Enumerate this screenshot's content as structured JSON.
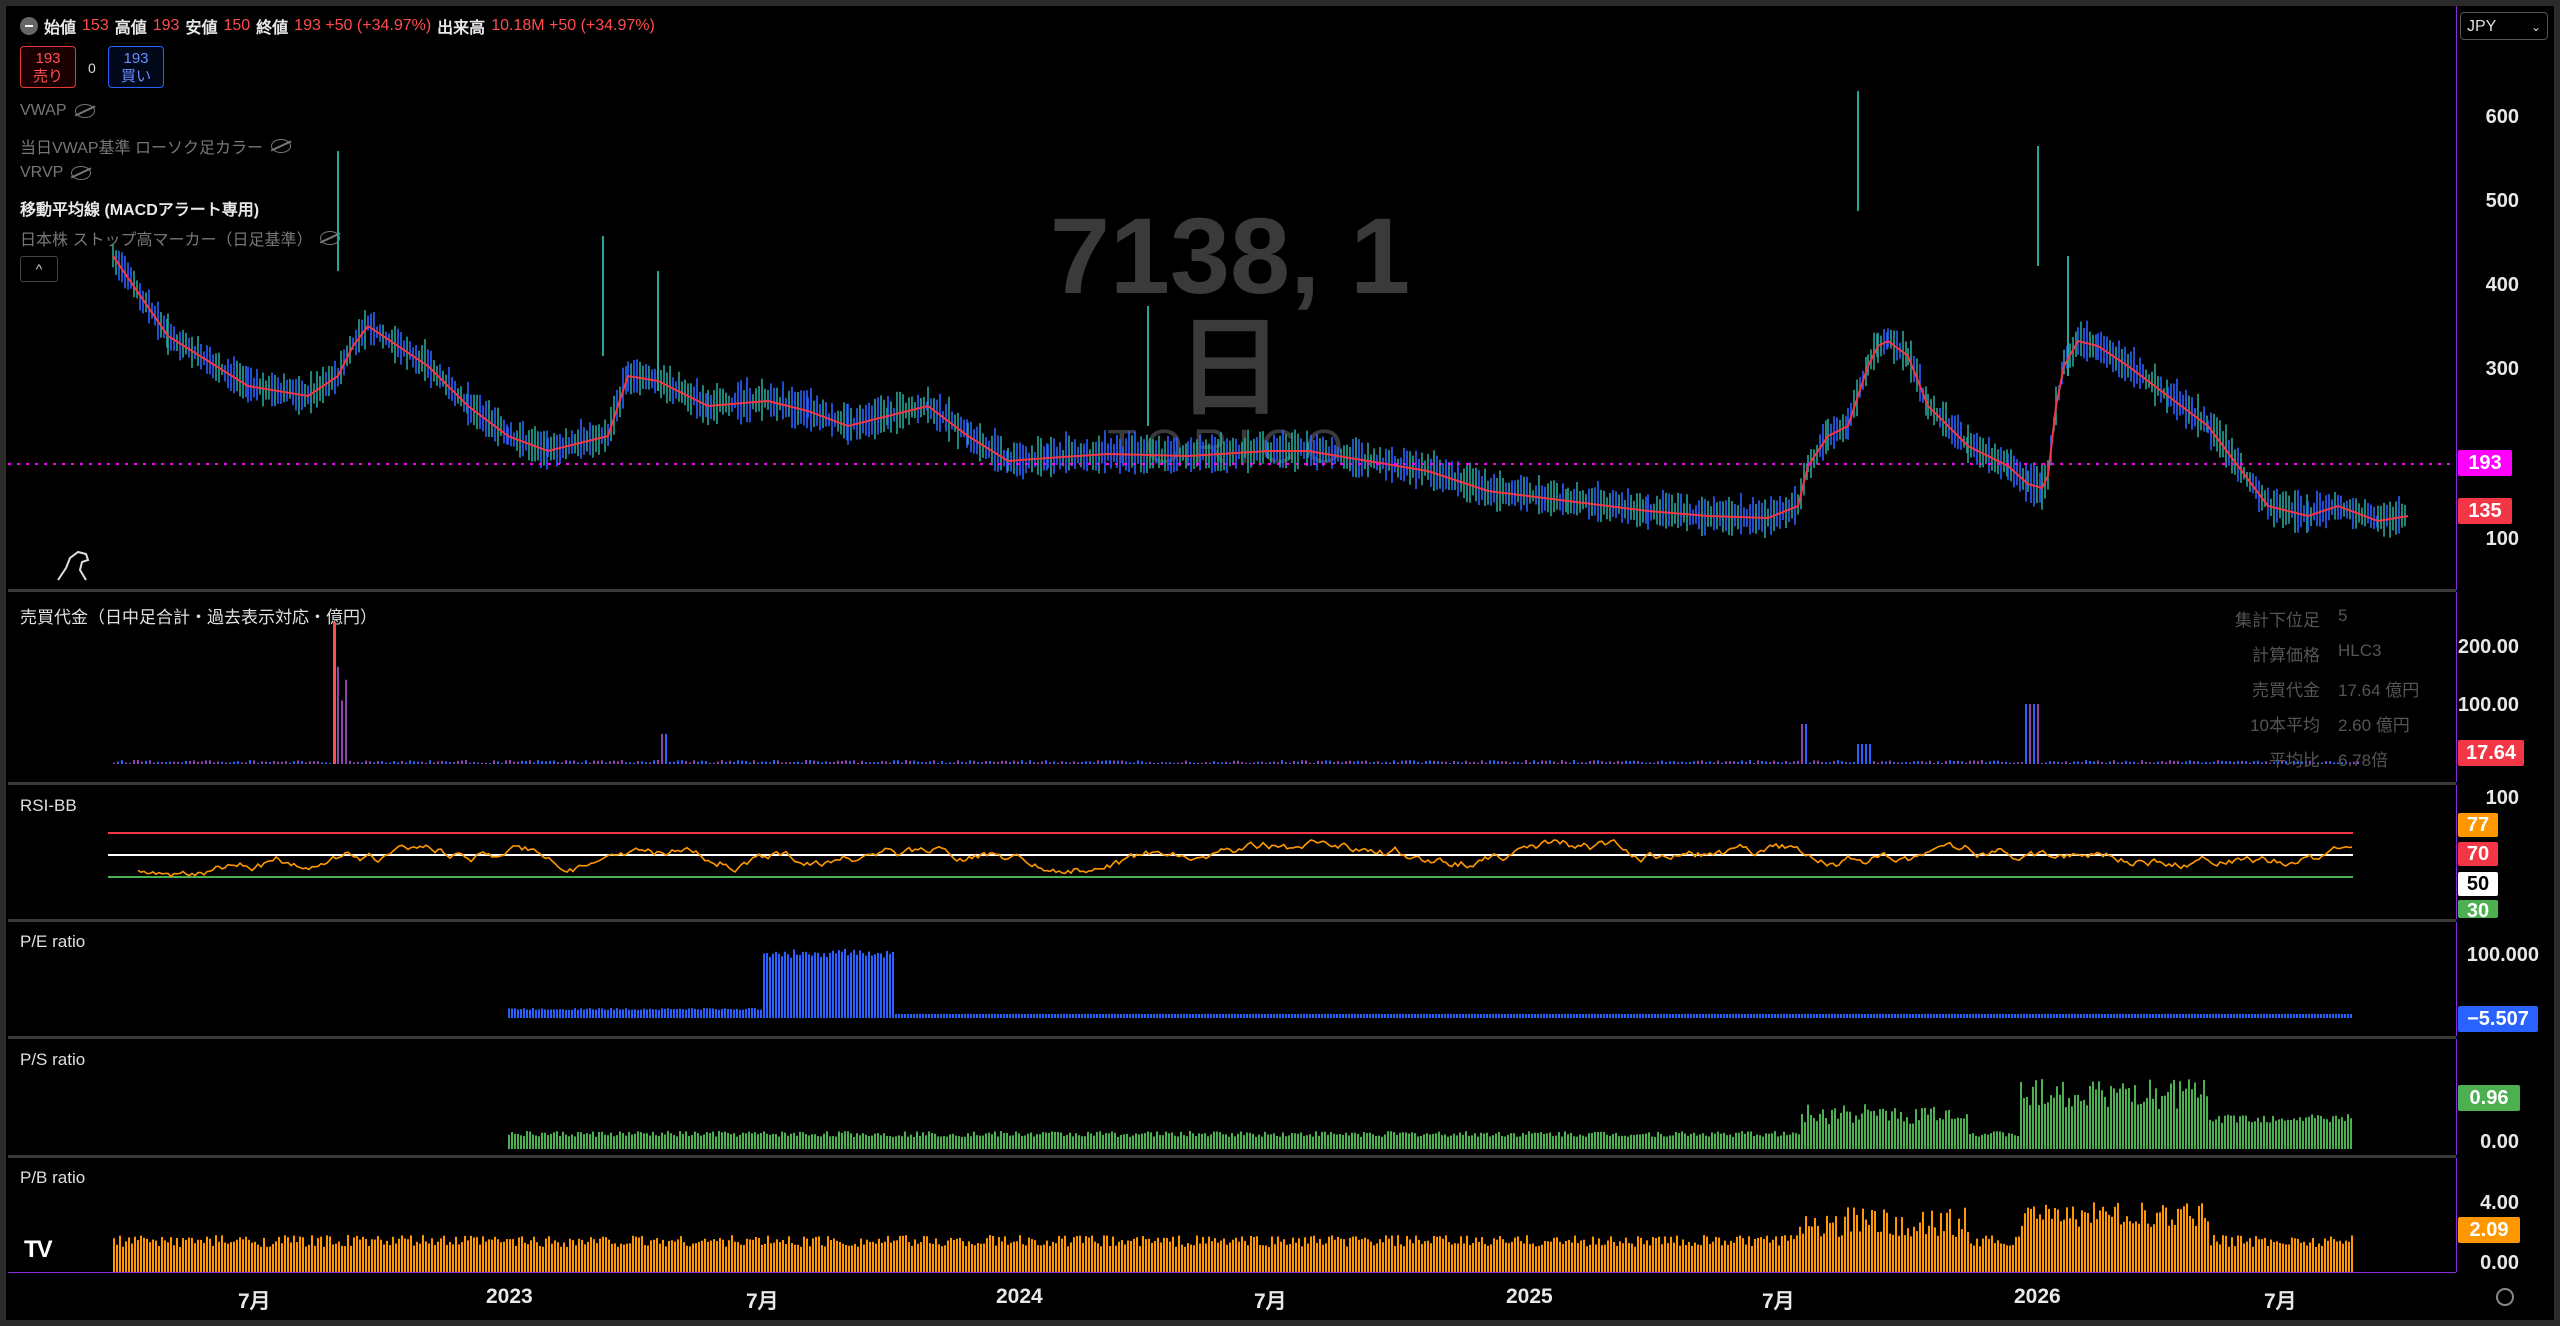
{
  "header": {
    "open_k": "始値",
    "open_v": "153",
    "high_k": "高値",
    "high_v": "193",
    "low_k": "安値",
    "low_v": "150",
    "close_k": "終値",
    "close_v": "193 +50 (+34.97%)",
    "volume_k": "出来高",
    "volume_v": "10.18M +50 (+34.97%)",
    "sell_price": "193",
    "sell_label": "売り",
    "spread": "0",
    "buy_price": "193",
    "buy_label": "買い",
    "currency": "JPY"
  },
  "indicators": [
    {
      "label": "VWAP",
      "hidden": true
    },
    {
      "label": "当日VWAP基準 ローソク足カラー",
      "hidden": true
    },
    {
      "label": "VRVP",
      "hidden": true
    },
    {
      "label": "移動平均線 (MACDアラート専用)",
      "hidden": false
    },
    {
      "label": "日本株 ストップ高マーカー（日足基準）",
      "hidden": true
    }
  ],
  "watermark": {
    "symbol": "7138, 1日",
    "name": "TORICO"
  },
  "price_pane": {
    "axis_labels": [
      "600",
      "500",
      "400",
      "300",
      "100"
    ],
    "last_price": "193",
    "ma_value": "135",
    "accent_last": "#ff00ff",
    "accent_ma": "#f23645"
  },
  "turnover_pane": {
    "title": "売買代金（日中足合計・過去表示対応・億円）",
    "axis_labels": [
      "200.00",
      "100.00"
    ],
    "last": "17.64",
    "stats": [
      {
        "k": "集計下位足",
        "v": "5"
      },
      {
        "k": "計算価格",
        "v": "HLC3"
      },
      {
        "k": "売買代金",
        "v": "17.64 億円"
      },
      {
        "k": "10本平均",
        "v": "2.60 億円"
      },
      {
        "k": "平均比",
        "v": "6.78倍"
      }
    ]
  },
  "rsi_pane": {
    "title": "RSI-BB",
    "axis_top": "100",
    "tags": [
      {
        "v": "77",
        "color": "#ff9800"
      },
      {
        "v": "70",
        "color": "#f23645"
      },
      {
        "v": "50",
        "color": "#ffffff"
      },
      {
        "v": "30",
        "color": "#4caf50"
      }
    ]
  },
  "pe_pane": {
    "title": "P/E ratio",
    "axis_label": "100.000",
    "last": "−5.507",
    "color": "#2962ff"
  },
  "ps_pane": {
    "title": "P/S ratio",
    "axis_label": "0.00",
    "last": "0.96",
    "color": "#4caf50"
  },
  "pb_pane": {
    "title": "P/B ratio",
    "axis_labels": [
      "4.00",
      "0.00"
    ],
    "last": "2.09",
    "color": "#ff9800"
  },
  "time_axis": [
    "7月",
    "2023",
    "7月",
    "2024",
    "7月",
    "2025",
    "7月",
    "2026",
    "7月"
  ],
  "logo": "TV"
}
